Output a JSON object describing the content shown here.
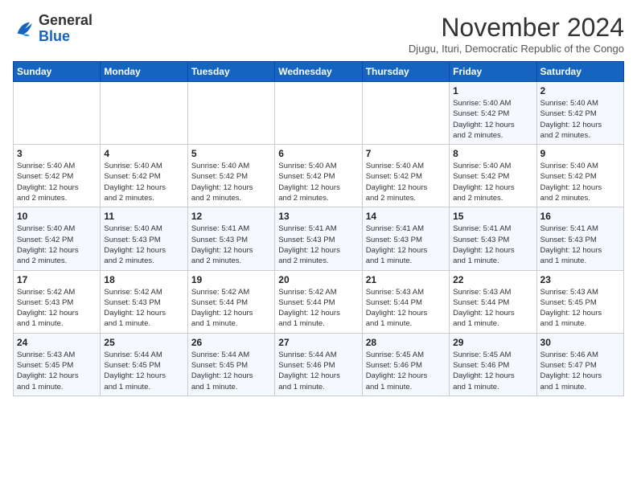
{
  "logo": {
    "general": "General",
    "blue": "Blue"
  },
  "title": "November 2024",
  "subtitle": "Djugu, Ituri, Democratic Republic of the Congo",
  "days_of_week": [
    "Sunday",
    "Monday",
    "Tuesday",
    "Wednesday",
    "Thursday",
    "Friday",
    "Saturday"
  ],
  "weeks": [
    [
      {
        "day": "",
        "info": ""
      },
      {
        "day": "",
        "info": ""
      },
      {
        "day": "",
        "info": ""
      },
      {
        "day": "",
        "info": ""
      },
      {
        "day": "",
        "info": ""
      },
      {
        "day": "1",
        "info": "Sunrise: 5:40 AM\nSunset: 5:42 PM\nDaylight: 12 hours\nand 2 minutes."
      },
      {
        "day": "2",
        "info": "Sunrise: 5:40 AM\nSunset: 5:42 PM\nDaylight: 12 hours\nand 2 minutes."
      }
    ],
    [
      {
        "day": "3",
        "info": "Sunrise: 5:40 AM\nSunset: 5:42 PM\nDaylight: 12 hours\nand 2 minutes."
      },
      {
        "day": "4",
        "info": "Sunrise: 5:40 AM\nSunset: 5:42 PM\nDaylight: 12 hours\nand 2 minutes."
      },
      {
        "day": "5",
        "info": "Sunrise: 5:40 AM\nSunset: 5:42 PM\nDaylight: 12 hours\nand 2 minutes."
      },
      {
        "day": "6",
        "info": "Sunrise: 5:40 AM\nSunset: 5:42 PM\nDaylight: 12 hours\nand 2 minutes."
      },
      {
        "day": "7",
        "info": "Sunrise: 5:40 AM\nSunset: 5:42 PM\nDaylight: 12 hours\nand 2 minutes."
      },
      {
        "day": "8",
        "info": "Sunrise: 5:40 AM\nSunset: 5:42 PM\nDaylight: 12 hours\nand 2 minutes."
      },
      {
        "day": "9",
        "info": "Sunrise: 5:40 AM\nSunset: 5:42 PM\nDaylight: 12 hours\nand 2 minutes."
      }
    ],
    [
      {
        "day": "10",
        "info": "Sunrise: 5:40 AM\nSunset: 5:42 PM\nDaylight: 12 hours\nand 2 minutes."
      },
      {
        "day": "11",
        "info": "Sunrise: 5:40 AM\nSunset: 5:43 PM\nDaylight: 12 hours\nand 2 minutes."
      },
      {
        "day": "12",
        "info": "Sunrise: 5:41 AM\nSunset: 5:43 PM\nDaylight: 12 hours\nand 2 minutes."
      },
      {
        "day": "13",
        "info": "Sunrise: 5:41 AM\nSunset: 5:43 PM\nDaylight: 12 hours\nand 2 minutes."
      },
      {
        "day": "14",
        "info": "Sunrise: 5:41 AM\nSunset: 5:43 PM\nDaylight: 12 hours\nand 1 minute."
      },
      {
        "day": "15",
        "info": "Sunrise: 5:41 AM\nSunset: 5:43 PM\nDaylight: 12 hours\nand 1 minute."
      },
      {
        "day": "16",
        "info": "Sunrise: 5:41 AM\nSunset: 5:43 PM\nDaylight: 12 hours\nand 1 minute."
      }
    ],
    [
      {
        "day": "17",
        "info": "Sunrise: 5:42 AM\nSunset: 5:43 PM\nDaylight: 12 hours\nand 1 minute."
      },
      {
        "day": "18",
        "info": "Sunrise: 5:42 AM\nSunset: 5:43 PM\nDaylight: 12 hours\nand 1 minute."
      },
      {
        "day": "19",
        "info": "Sunrise: 5:42 AM\nSunset: 5:44 PM\nDaylight: 12 hours\nand 1 minute."
      },
      {
        "day": "20",
        "info": "Sunrise: 5:42 AM\nSunset: 5:44 PM\nDaylight: 12 hours\nand 1 minute."
      },
      {
        "day": "21",
        "info": "Sunrise: 5:43 AM\nSunset: 5:44 PM\nDaylight: 12 hours\nand 1 minute."
      },
      {
        "day": "22",
        "info": "Sunrise: 5:43 AM\nSunset: 5:44 PM\nDaylight: 12 hours\nand 1 minute."
      },
      {
        "day": "23",
        "info": "Sunrise: 5:43 AM\nSunset: 5:45 PM\nDaylight: 12 hours\nand 1 minute."
      }
    ],
    [
      {
        "day": "24",
        "info": "Sunrise: 5:43 AM\nSunset: 5:45 PM\nDaylight: 12 hours\nand 1 minute."
      },
      {
        "day": "25",
        "info": "Sunrise: 5:44 AM\nSunset: 5:45 PM\nDaylight: 12 hours\nand 1 minute."
      },
      {
        "day": "26",
        "info": "Sunrise: 5:44 AM\nSunset: 5:45 PM\nDaylight: 12 hours\nand 1 minute."
      },
      {
        "day": "27",
        "info": "Sunrise: 5:44 AM\nSunset: 5:46 PM\nDaylight: 12 hours\nand 1 minute."
      },
      {
        "day": "28",
        "info": "Sunrise: 5:45 AM\nSunset: 5:46 PM\nDaylight: 12 hours\nand 1 minute."
      },
      {
        "day": "29",
        "info": "Sunrise: 5:45 AM\nSunset: 5:46 PM\nDaylight: 12 hours\nand 1 minute."
      },
      {
        "day": "30",
        "info": "Sunrise: 5:46 AM\nSunset: 5:47 PM\nDaylight: 12 hours\nand 1 minute."
      }
    ]
  ]
}
